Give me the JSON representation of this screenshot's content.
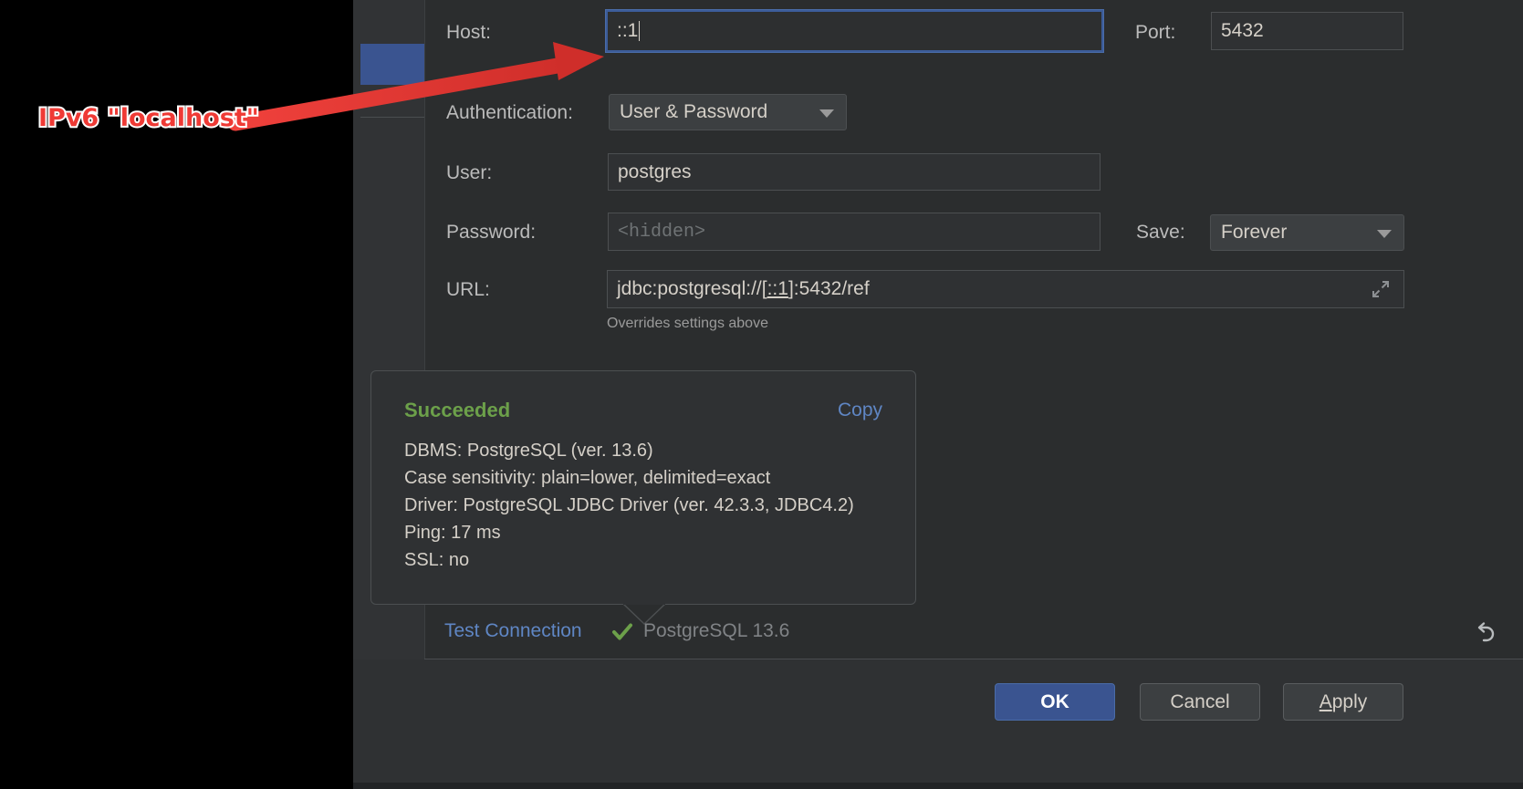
{
  "annotation": {
    "text": "IPv6 \"localhost\"",
    "color": "#ef3a35",
    "outline_color": "#ffffff"
  },
  "dialog": {
    "fields": {
      "host": {
        "label": "Host:",
        "value": "::1",
        "focused": true
      },
      "port": {
        "label": "Port:",
        "value": "5432"
      },
      "authentication": {
        "label": "Authentication:",
        "value": "User & Password"
      },
      "user": {
        "label": "User:",
        "value": "postgres"
      },
      "password": {
        "label": "Password:",
        "placeholder": "<hidden>",
        "value": ""
      },
      "save": {
        "label": "Save:",
        "value": "Forever"
      },
      "url": {
        "label": "URL:",
        "prefix": "jdbc:postgresql://[",
        "link": "::1",
        "suffix": "]:5432/ref",
        "full": "jdbc:postgresql://[::1]:5432/ref",
        "hint": "Overrides settings above"
      }
    },
    "tooltip": {
      "status": "Succeeded",
      "status_color": "#6ca04a",
      "copy_label": "Copy",
      "lines": [
        "DBMS: PostgreSQL (ver. 13.6)",
        "Case sensitivity: plain=lower, delimited=exact",
        "Driver: PostgreSQL JDBC Driver (ver. 42.3.3, JDBC4.2)",
        "Ping: 17 ms",
        "SSL: no"
      ]
    },
    "test_bar": {
      "link_label": "Test Connection",
      "link_color": "#5f86c4",
      "status_icon": "check-icon",
      "status_color": "#6ca04a",
      "dbms_label": "PostgreSQL 13.6"
    },
    "buttons": {
      "ok": "OK",
      "cancel": "Cancel",
      "apply_mnemonic": "A",
      "apply_rest": "pply"
    },
    "icons": {
      "expand": "expand-icon",
      "revert": "revert-icon",
      "dropdown": "chevron-down-icon"
    }
  }
}
